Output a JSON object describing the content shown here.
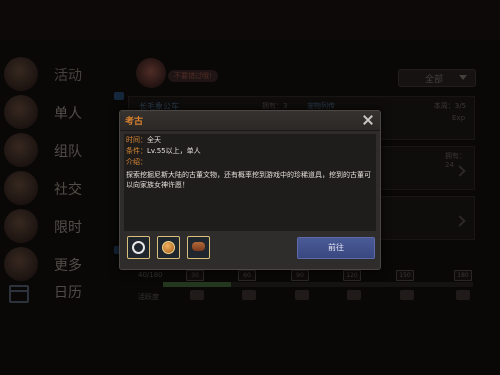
{
  "sidebar": {
    "items": [
      {
        "label": "活动",
        "icon": "character-icon"
      },
      {
        "label": "单人",
        "icon": "character-icon"
      },
      {
        "label": "组队",
        "icon": "character-icon"
      },
      {
        "label": "社交",
        "icon": "character-icon"
      },
      {
        "label": "限时",
        "icon": "character-icon"
      },
      {
        "label": "更多",
        "icon": "character-icon"
      }
    ],
    "calendar_label": "日历"
  },
  "speech_bubble": "不要错过哦!",
  "filter": {
    "selected": "全部"
  },
  "list": {
    "rows": [
      {
        "title": "长毛象公车",
        "owned_label": "拥有：3",
        "right_title": "宠物列传",
        "progress": "本周：3/5",
        "exp": "Exp"
      },
      {
        "title": "",
        "owned_label": "拥有：24",
        "right_title": "",
        "progress": "",
        "exp": ""
      }
    ]
  },
  "activity": {
    "label": "活跃度",
    "current": "40/180",
    "milestones": [
      "30",
      "60",
      "90",
      "120",
      "150",
      "180"
    ],
    "progress_fraction": 0.22
  },
  "dialog": {
    "title": "考古",
    "time_label": "时间：",
    "time_value": "全天",
    "condition_label": "条件：",
    "condition_value": "Lv.55以上，单人",
    "intro_label": "介绍：",
    "description": "探索挖掘尼斯大陆的古董文物，还有概率挖到游戏中的珍稀道具，挖到的古董可以向家族女神许愿！",
    "rewards": [
      "ring-icon",
      "magnifier-gem-icon",
      "treat-icon"
    ],
    "goto_label": "前往"
  }
}
